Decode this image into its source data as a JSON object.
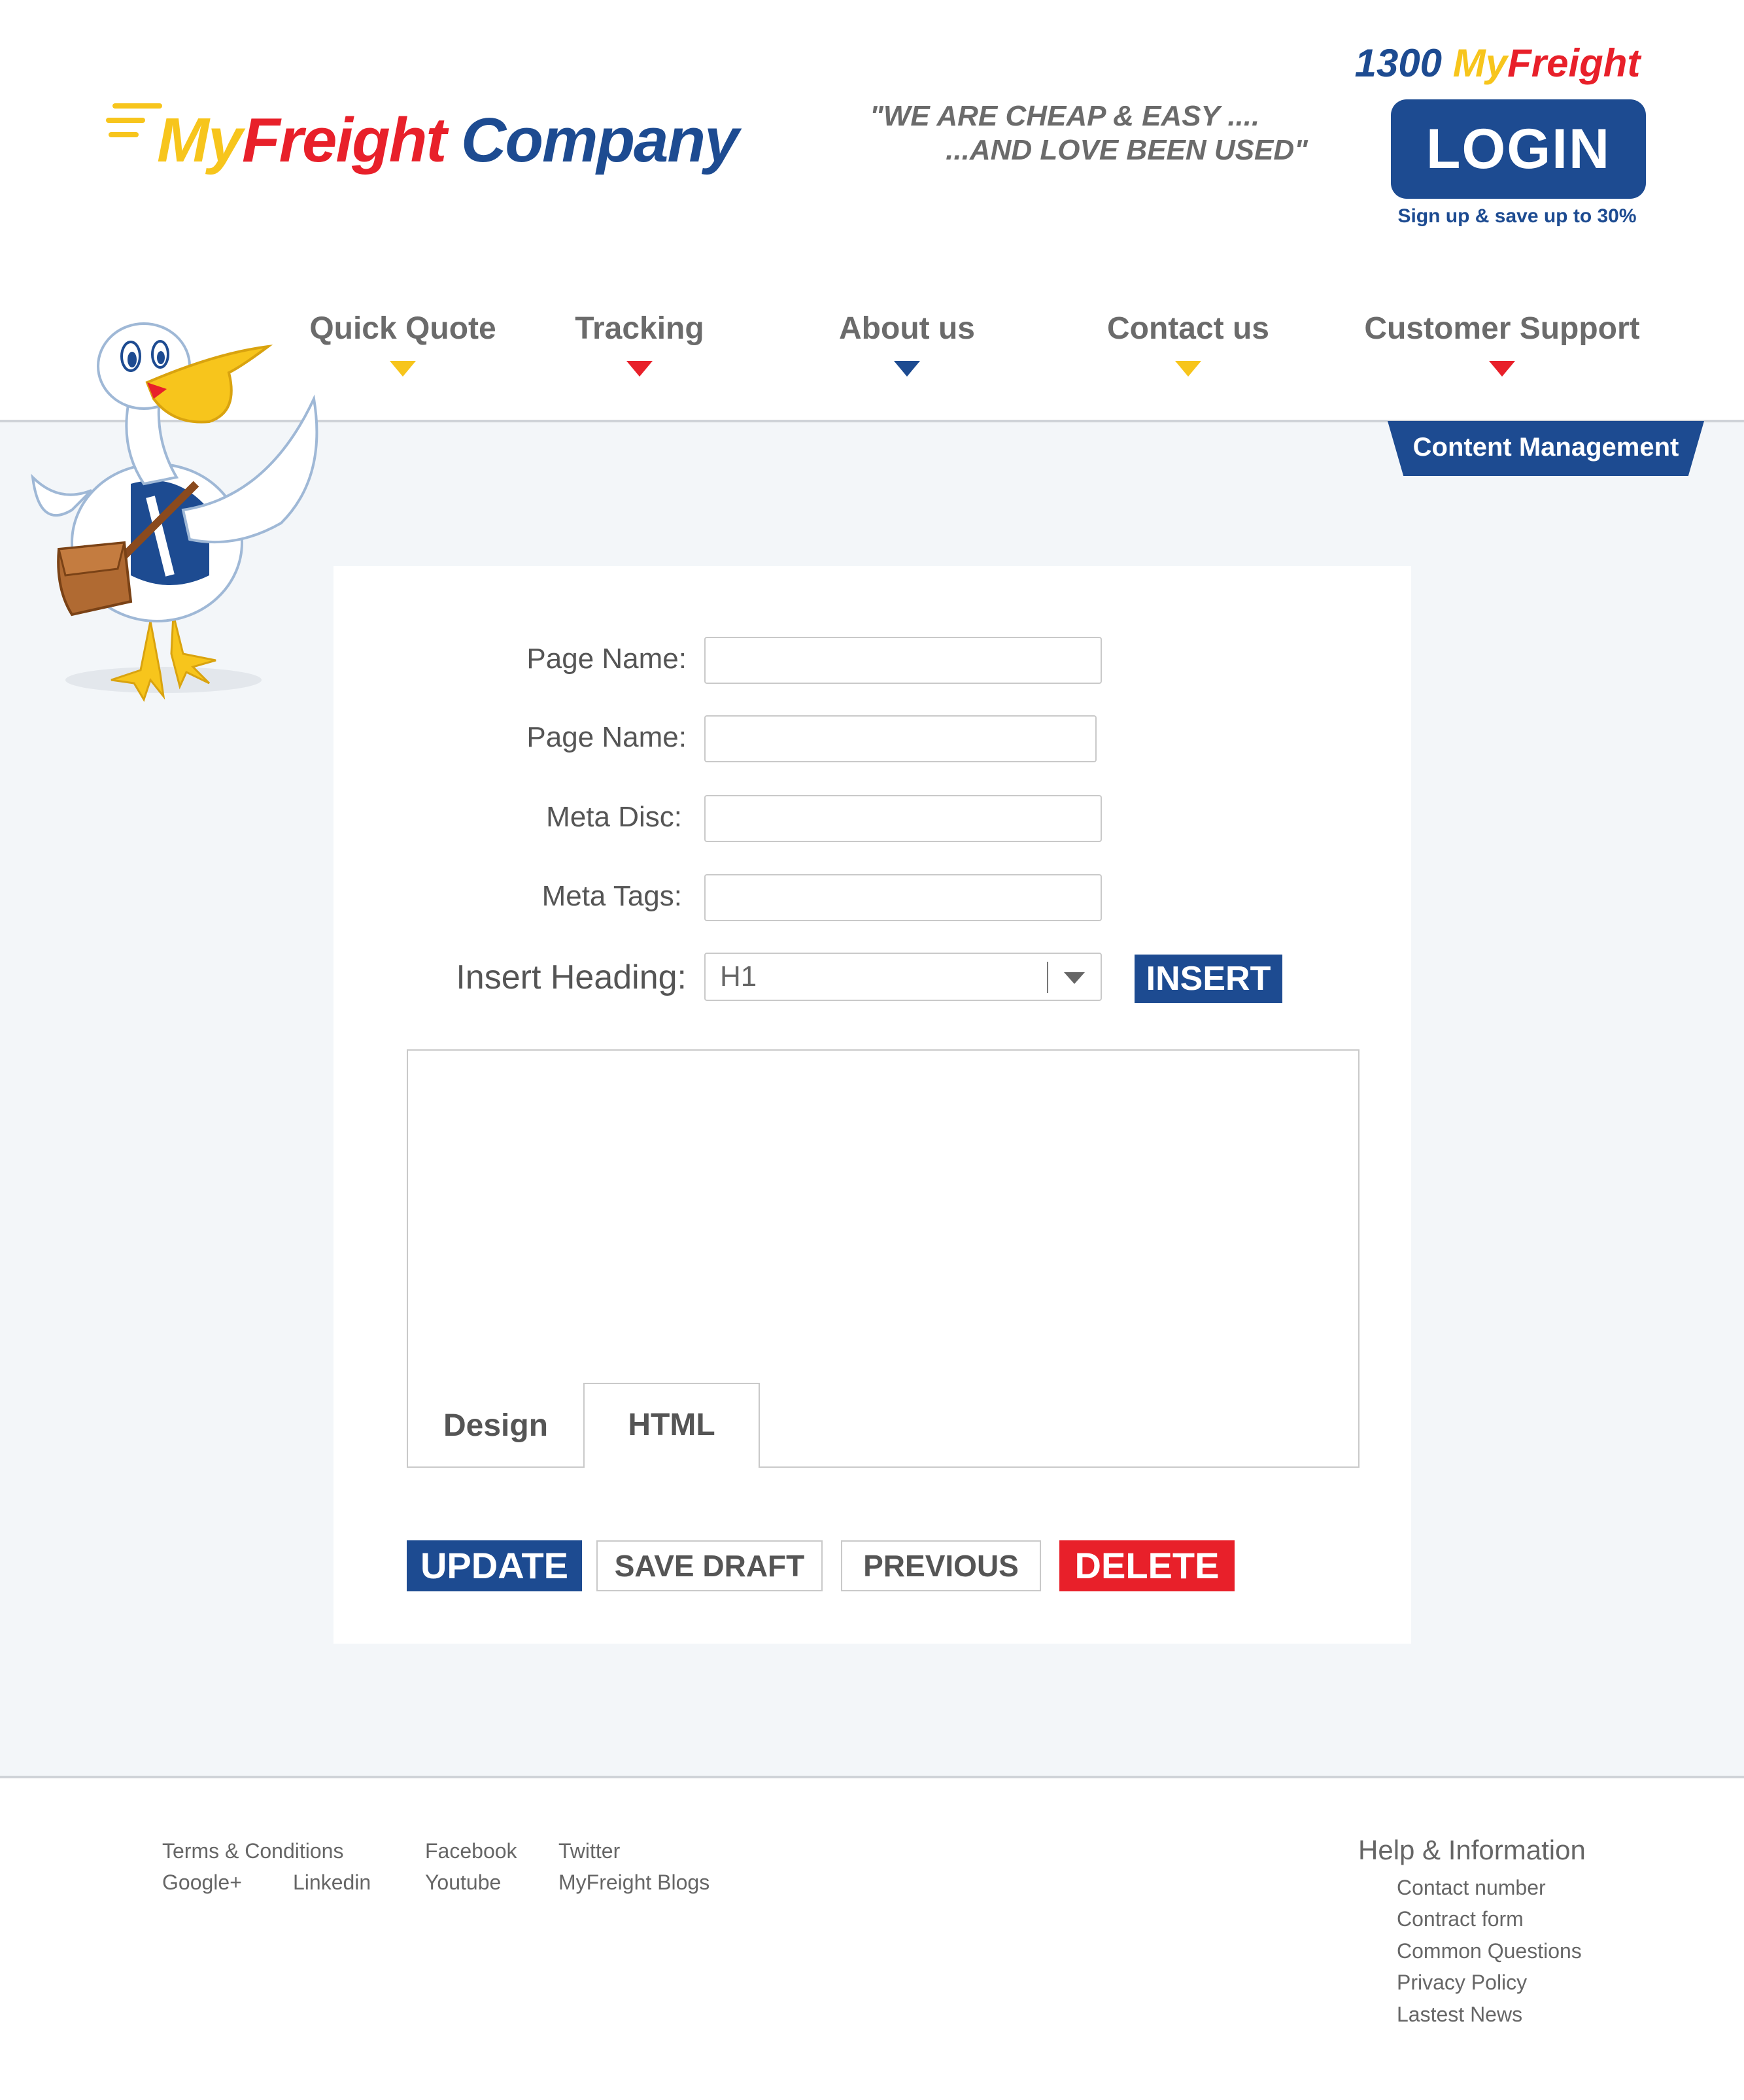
{
  "header": {
    "logo": {
      "my": "My",
      "freight": "Freight",
      "company": "Company"
    },
    "tagline": {
      "line1": "\"WE ARE CHEAP & EASY ....",
      "line2": "...AND LOVE BEEN USED\""
    },
    "phone": {
      "number": "1300",
      "my": "My",
      "freight": "Freight"
    },
    "login_label": "LOGIN",
    "signup_note": "Sign up & save up to 30%"
  },
  "nav": {
    "items": [
      {
        "label": "Quick Quote",
        "color": "#f7c51c"
      },
      {
        "label": "Tracking",
        "color": "#e8202a"
      },
      {
        "label": "About us",
        "color": "#1d4b91"
      },
      {
        "label": "Contact us",
        "color": "#f7c51c"
      },
      {
        "label": "Customer Support",
        "color": "#e8202a"
      }
    ]
  },
  "cms_tab_label": "Content Management",
  "form": {
    "fields": [
      {
        "label": "Page Name:",
        "value": "",
        "placeholder": ""
      },
      {
        "label": "Page Name:",
        "value": "",
        "placeholder": ""
      },
      {
        "label": "Meta Disc:",
        "value": "",
        "placeholder": ""
      },
      {
        "label": "Meta Tags:",
        "value": "",
        "placeholder": ""
      }
    ],
    "insert_heading_label": "Insert Heading:",
    "heading_selected": "H1",
    "insert_button": "INSERT"
  },
  "editor": {
    "tabs": [
      {
        "label": "Design"
      },
      {
        "label": "HTML"
      }
    ]
  },
  "actions": {
    "update": "UPDATE",
    "save_draft": "SAVE DRAFT",
    "previous": "PREVIOUS",
    "delete": "DELETE"
  },
  "footer": {
    "links": {
      "terms": "Terms & Conditions",
      "google": "Google+",
      "linkedin": "Linkedin",
      "facebook": "Facebook",
      "youtube": "Youtube",
      "twitter": "Twitter",
      "blogs": "MyFreight Blogs"
    },
    "help": {
      "title": "Help & Information",
      "items": [
        {
          "label": "Contact number"
        },
        {
          "label": "Contract form"
        },
        {
          "label": "Common Questions"
        },
        {
          "label": "Privacy Policy"
        },
        {
          "label": "Lastest News"
        }
      ]
    }
  },
  "colors": {
    "brand_blue": "#1d4b91",
    "brand_yellow": "#f7c51c",
    "brand_red": "#e8202a",
    "page_bg": "#f3f6f9"
  }
}
